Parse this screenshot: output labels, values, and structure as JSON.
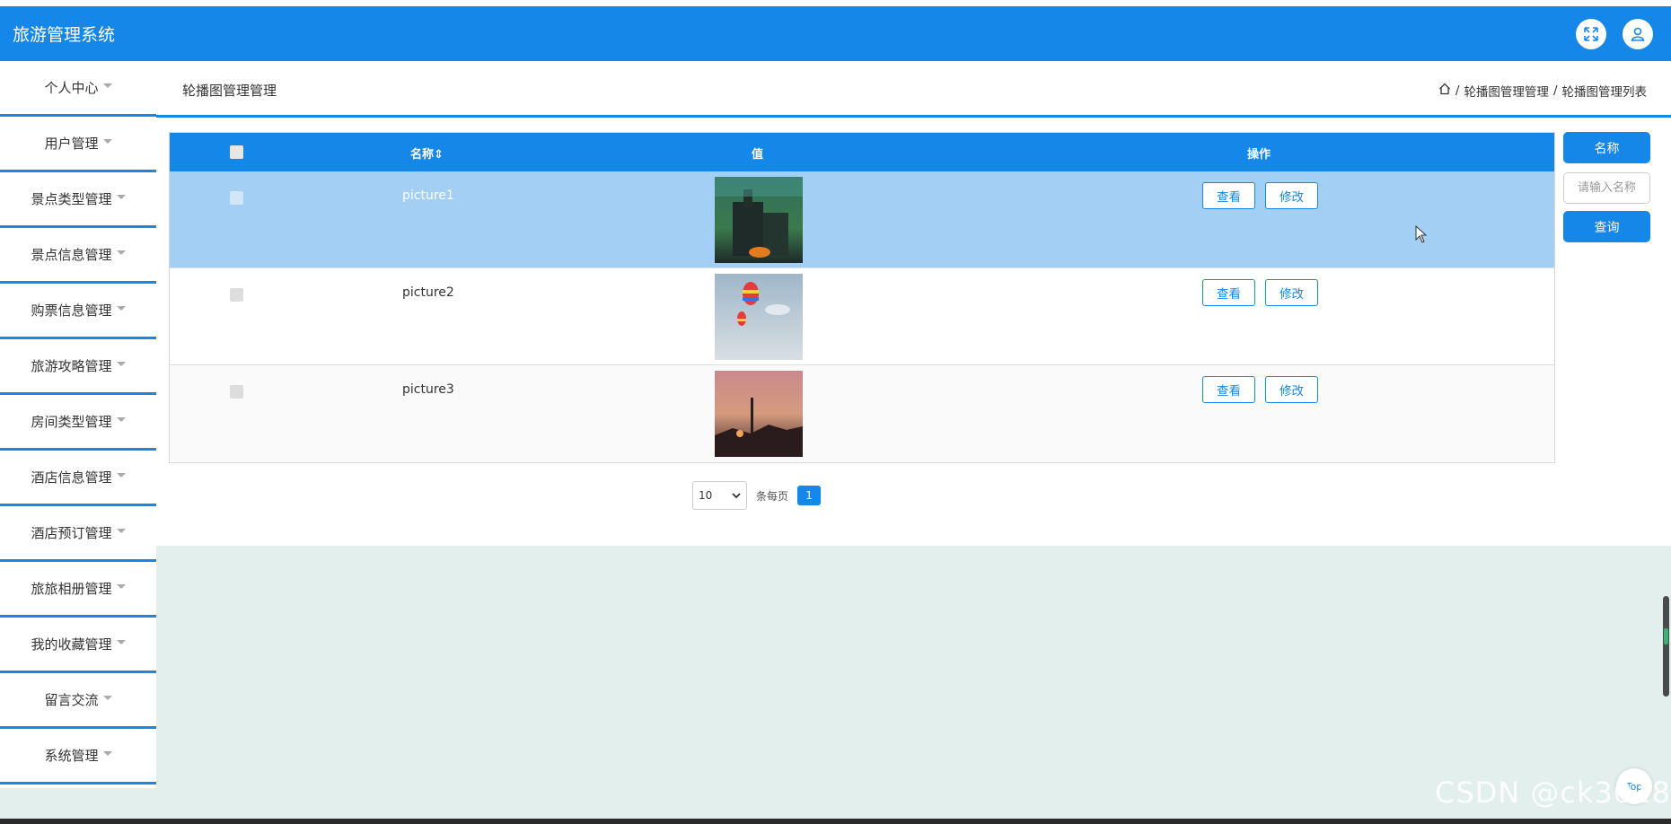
{
  "app": {
    "title": "旅游管理系统"
  },
  "top_icons": {
    "fullscreen": "fullscreen-icon",
    "user": "user-icon"
  },
  "sidebar": {
    "items": [
      {
        "label": "个人中心"
      },
      {
        "label": "用户管理"
      },
      {
        "label": "景点类型管理"
      },
      {
        "label": "景点信息管理"
      },
      {
        "label": "购票信息管理"
      },
      {
        "label": "旅游攻略管理"
      },
      {
        "label": "房间类型管理"
      },
      {
        "label": "酒店信息管理"
      },
      {
        "label": "酒店预订管理"
      },
      {
        "label": "旅旅相册管理"
      },
      {
        "label": "我的收藏管理"
      },
      {
        "label": "留言交流"
      },
      {
        "label": "系统管理"
      }
    ]
  },
  "header": {
    "page_title": "轮播图管理管理",
    "breadcrumb": {
      "sep1": "/",
      "crumb1": "轮播图管理管理",
      "sep2": "/",
      "crumb2": "轮播图管理列表"
    }
  },
  "table": {
    "columns": {
      "name": "名称",
      "sort": "⇕",
      "value": "值",
      "actions": "操作"
    },
    "view_label": "查看",
    "edit_label": "修改",
    "rows": [
      {
        "name": "picture1",
        "image": "castle-image"
      },
      {
        "name": "picture2",
        "image": "balloon-image"
      },
      {
        "name": "picture3",
        "image": "sunset-image"
      }
    ]
  },
  "pagination": {
    "page_size": "10",
    "per_page_label": "条每页",
    "current_page": "1"
  },
  "search": {
    "name_label": "名称",
    "placeholder": "请输入名称",
    "query_button": "查询"
  },
  "back_to_top": "Top",
  "watermark": "CSDN @ck3018",
  "colors": {
    "primary": "#1587e9",
    "selected_row": "#a3cff5",
    "page_bg": "#e3efec"
  }
}
